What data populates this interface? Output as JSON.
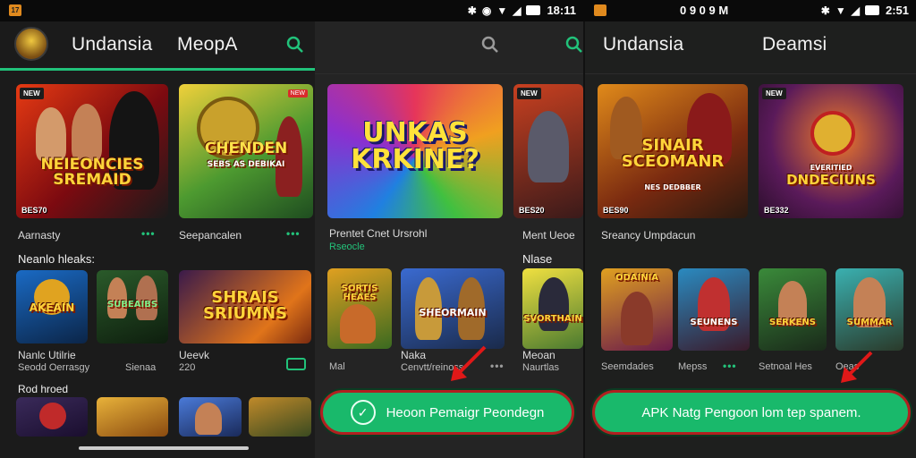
{
  "status": {
    "left": {
      "time": "18:11",
      "badge": "17"
    },
    "right": {
      "time": "2:51",
      "left_text": "0 9 0 9 M"
    }
  },
  "panel1": {
    "title": "Undansia",
    "tab": "MeopA",
    "top_cards": [
      {
        "caption": "NEIEONCIES SREMAID",
        "badge": "NEW",
        "sub": "BES70"
      },
      {
        "caption": "CHENDEN",
        "sub2": "SEBS AS DEBIKAI",
        "badge": "NEW"
      }
    ],
    "top_labels": [
      {
        "title": "Aarnasty"
      },
      {
        "title": "Seepancalen"
      }
    ],
    "section1": "Neanlo hleaks:",
    "row2_cards": [
      {
        "caption": "AKEAIN"
      },
      {
        "caption": "SUBEAIBS"
      },
      {
        "caption": "SHRAIS SRIUMNS"
      }
    ],
    "row2_labels": [
      {
        "title": "Nanlc Utilrie",
        "sub": "Seodd Oerrasgy"
      },
      {
        "title": "Sienaa"
      },
      {
        "title": "Ueevk",
        "sub": "220"
      }
    ],
    "section2": "Rod hroed"
  },
  "panel2": {
    "top_card": {
      "caption": "UNKAS KRKINE?"
    },
    "top_labels": [
      {
        "title": "Prentet Cnet Ursrohl",
        "sub": "Rseocle"
      },
      {
        "title": "Ment Ueoe"
      }
    ],
    "side_card": {
      "sub": "BES20"
    },
    "section": "Nlase",
    "row2_cards": [
      {
        "caption": "SORTIS HEAES"
      },
      {
        "caption": "SHEORMAIN"
      },
      {
        "caption": "SVORTHAIN"
      }
    ],
    "row2_labels": [
      {
        "title": "Mal"
      },
      {
        "title": "Naka",
        "sub": "Cenvtt/reinoss"
      },
      {
        "title": "Meoan",
        "sub": "Naurtlas"
      }
    ],
    "cta": {
      "label": "Heoon Pemaigr Peondegn"
    }
  },
  "panel3": {
    "title": "Undansia",
    "tab": "Deamsi",
    "top_cards": [
      {
        "caption": "SINAIR SCEOMANR",
        "sub2": "NES DEDBBER",
        "sub": "BES90"
      },
      {
        "caption": "DNDECIUNS",
        "sub2": "EVERITIED",
        "sub": "BE332",
        "badge": "NEW"
      }
    ],
    "top_label": "Sreancy Umpdacun",
    "row2_cards": [
      {
        "caption": "ODAINIA"
      },
      {
        "caption": "SEUNENS"
      },
      {
        "caption": "SERKENS"
      },
      {
        "caption": "SUMMAR"
      }
    ],
    "row2_labels": [
      {
        "title": "Seemdades"
      },
      {
        "title": "Mepss"
      },
      {
        "title": "Setnoal Hes"
      },
      {
        "title": "Oeas"
      }
    ],
    "cta": {
      "label": "APK Natg Pengoon lom tep spanem."
    }
  },
  "colors": {
    "accent": "#21c27a",
    "cta": "#19b96b",
    "cta_border": "#b02020",
    "arrow": "#e01818"
  }
}
